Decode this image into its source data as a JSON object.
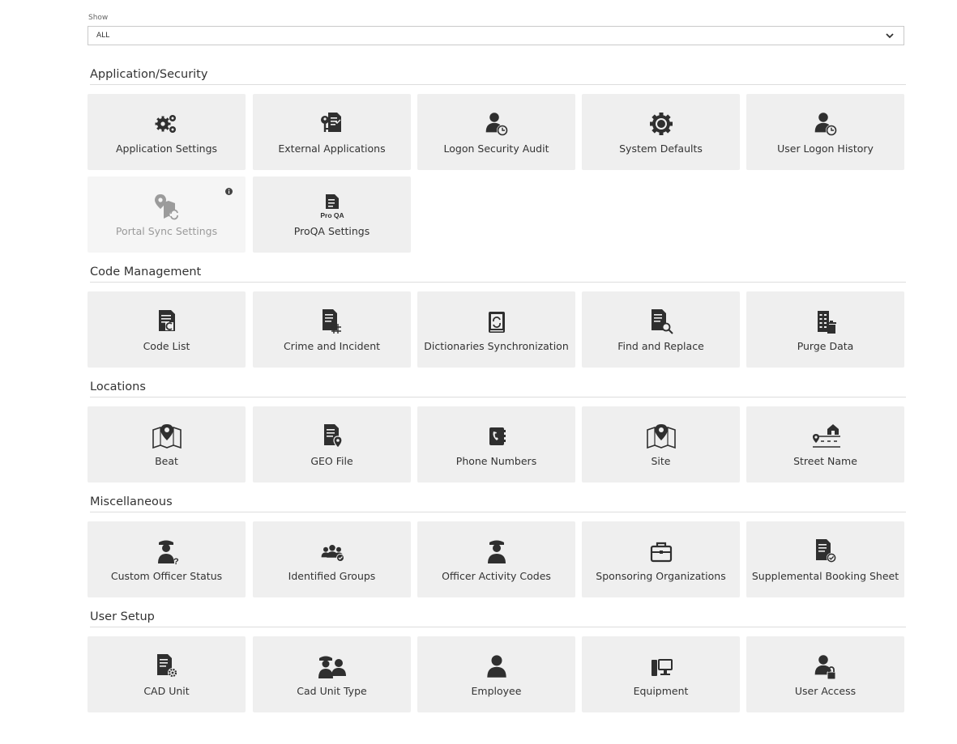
{
  "filter": {
    "label": "Show",
    "value": "ALL",
    "icon": "chevron-down-icon"
  },
  "sections": [
    {
      "title": "Application/Security",
      "tiles": [
        {
          "label": "Application Settings",
          "icon": "gears-icon"
        },
        {
          "label": "External Applications",
          "icon": "key-checklist-icon"
        },
        {
          "label": "Logon Security Audit",
          "icon": "user-clock-icon"
        },
        {
          "label": "System Defaults",
          "icon": "gear-icon"
        },
        {
          "label": "User Logon History",
          "icon": "user-clock-icon"
        },
        {
          "label": "Portal Sync Settings",
          "icon": "map-sync-icon",
          "state": "disabled"
        },
        {
          "label": "ProQA Settings",
          "icon": "proqa-document-icon",
          "icon_text": "Pro QA"
        }
      ]
    },
    {
      "title": "Code Management",
      "tiles": [
        {
          "label": "Code List",
          "icon": "document-list-icon"
        },
        {
          "label": "Crime and Incident",
          "icon": "document-hash-icon"
        },
        {
          "label": "Dictionaries Synchronization",
          "icon": "book-sync-icon"
        },
        {
          "label": "Find and Replace",
          "icon": "document-search-icon"
        },
        {
          "label": "Purge Data",
          "icon": "building-trash-icon"
        }
      ]
    },
    {
      "title": "Locations",
      "tiles": [
        {
          "label": "Beat",
          "icon": "map-pin-icon"
        },
        {
          "label": "GEO File",
          "icon": "document-location-icon"
        },
        {
          "label": "Phone Numbers",
          "icon": "phone-book-icon"
        },
        {
          "label": "Site",
          "icon": "map-pin-icon"
        },
        {
          "label": "Street Name",
          "icon": "house-street-icon"
        }
      ]
    },
    {
      "title": "Miscellaneous",
      "tiles": [
        {
          "label": "Custom Officer Status",
          "icon": "officer-question-icon"
        },
        {
          "label": "Identified Groups",
          "icon": "group-check-icon"
        },
        {
          "label": "Officer Activity Codes",
          "icon": "officer-icon"
        },
        {
          "label": "Sponsoring Organizations",
          "icon": "briefcase-icon"
        },
        {
          "label": "Supplemental Booking Sheet",
          "icon": "document-check-icon"
        }
      ]
    },
    {
      "title": "User Setup",
      "tiles": [
        {
          "label": "CAD Unit",
          "icon": "document-gear-icon"
        },
        {
          "label": "Cad Unit Type",
          "icon": "officers-icon"
        },
        {
          "label": "Employee",
          "icon": "user-icon"
        },
        {
          "label": "Equipment",
          "icon": "computer-icon"
        },
        {
          "label": "User Access",
          "icon": "user-lock-icon"
        }
      ]
    }
  ],
  "colors": {
    "tile_bg": "#efefef",
    "icon": "#2f2f2f",
    "disabled_text": "#9a9a9a"
  }
}
